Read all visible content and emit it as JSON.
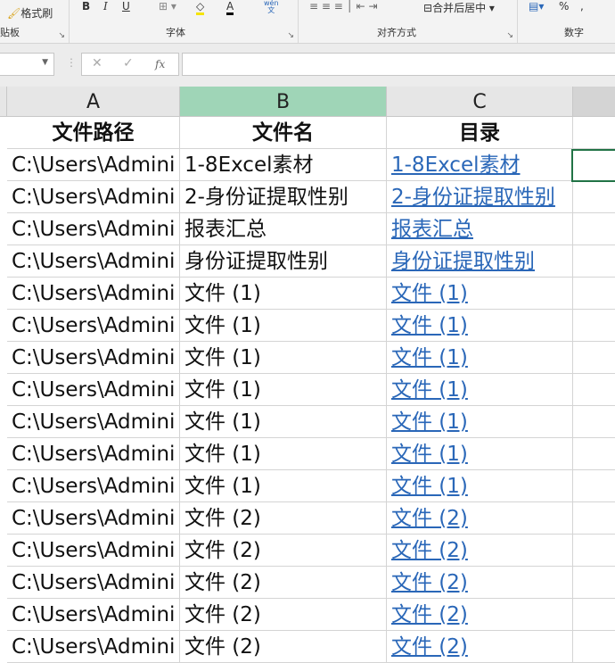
{
  "ribbon": {
    "clipboard": {
      "format_painter": "格式刷",
      "label": "贴板"
    },
    "font": {
      "bold": "B",
      "italic": "I",
      "underline": "U",
      "font_color": "A",
      "phonetic_top": "wén",
      "phonetic_bottom": "文",
      "label": "字体"
    },
    "alignment": {
      "merge": "合并后居中",
      "label": "对齐方式"
    },
    "number": {
      "percent": "%",
      "comma": ",",
      "label": "数字"
    }
  },
  "formula_bar": {
    "cancel": "✕",
    "enter": "✓",
    "fx": "fx",
    "value": ""
  },
  "columns": [
    "A",
    "B",
    "C"
  ],
  "headers": [
    "文件路径",
    "文件名",
    "目录"
  ],
  "rows": [
    [
      "C:\\Users\\Admini",
      "1-8Excel素材",
      "1-8Excel素材"
    ],
    [
      "C:\\Users\\Admini",
      "2-身份证提取性别",
      "2-身份证提取性别"
    ],
    [
      "C:\\Users\\Admini",
      "报表汇总",
      "报表汇总"
    ],
    [
      "C:\\Users\\Admini",
      "身份证提取性别",
      "身份证提取性别"
    ],
    [
      "C:\\Users\\Admini",
      "文件 (1)",
      "文件 (1)"
    ],
    [
      "C:\\Users\\Admini",
      "文件 (1)",
      "文件 (1)"
    ],
    [
      "C:\\Users\\Admini",
      "文件 (1)",
      "文件 (1)"
    ],
    [
      "C:\\Users\\Admini",
      "文件 (1)",
      "文件 (1)"
    ],
    [
      "C:\\Users\\Admini",
      "文件 (1)",
      "文件 (1)"
    ],
    [
      "C:\\Users\\Admini",
      "文件 (1)",
      "文件 (1)"
    ],
    [
      "C:\\Users\\Admini",
      "文件 (1)",
      "文件 (1)"
    ],
    [
      "C:\\Users\\Admini",
      "文件 (2)",
      "文件 (2)"
    ],
    [
      "C:\\Users\\Admini",
      "文件 (2)",
      "文件 (2)"
    ],
    [
      "C:\\Users\\Admini",
      "文件 (2)",
      "文件 (2)"
    ],
    [
      "C:\\Users\\Admini",
      "文件 (2)",
      "文件 (2)"
    ],
    [
      "C:\\Users\\Admini",
      "文件 (2)",
      "文件 (2)"
    ]
  ]
}
